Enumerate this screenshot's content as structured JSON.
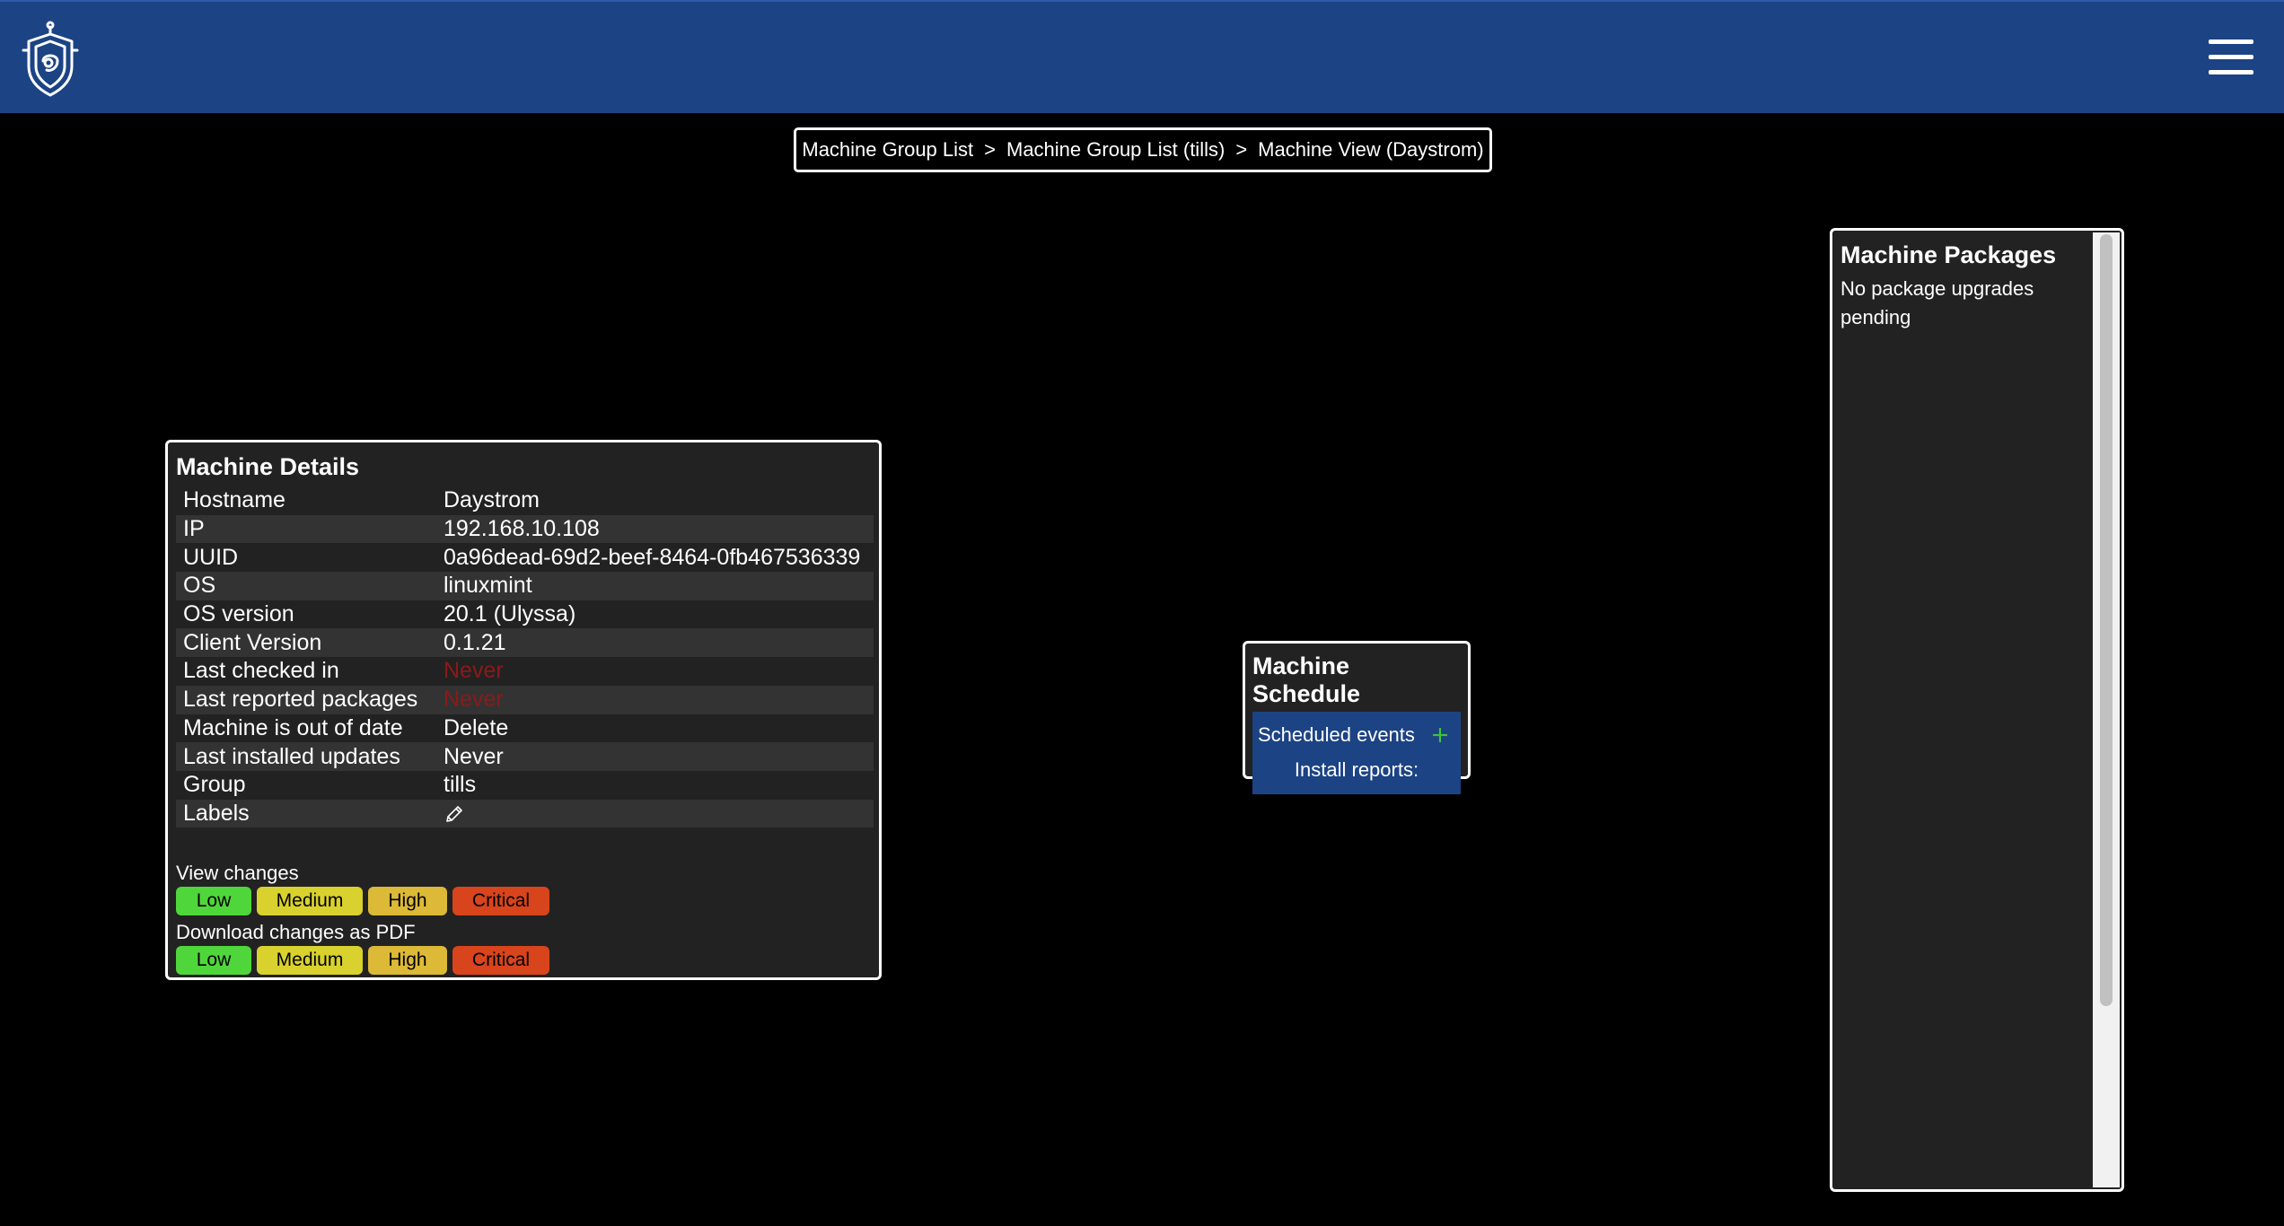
{
  "header": {
    "logo_icon": "shield-logo-icon",
    "menu_icon": "hamburger-menu-icon"
  },
  "breadcrumb": {
    "items": [
      "Machine Group List",
      "Machine Group List (tills)",
      "Machine View (Daystrom)"
    ],
    "separator": ">"
  },
  "details": {
    "title": "Machine Details",
    "rows": [
      {
        "key": "Hostname",
        "value": "Daystrom"
      },
      {
        "key": "IP",
        "value": "192.168.10.108"
      },
      {
        "key": "UUID",
        "value": "0a96dead-69d2-beef-8464-0fb467536339"
      },
      {
        "key": "OS",
        "value": "linuxmint"
      },
      {
        "key": "OS version",
        "value": "20.1 (Ulyssa)"
      },
      {
        "key": "Client Version",
        "value": "0.1.21"
      },
      {
        "key": "Last checked in",
        "value": "Never"
      },
      {
        "key": "Last reported packages",
        "value": "Never"
      },
      {
        "key": "Machine is out of date",
        "value": "Delete"
      },
      {
        "key": "Last installed updates",
        "value": "Never"
      },
      {
        "key": "Group",
        "value": "tills"
      },
      {
        "key": "Labels",
        "value": ""
      }
    ],
    "labels_icon": "pencil-icon",
    "view_changes_label": "View changes",
    "download_changes_label": "Download changes as PDF",
    "severity_buttons": {
      "low": "Low",
      "medium": "Medium",
      "high": "High",
      "critical": "Critical"
    }
  },
  "schedule": {
    "title": "Machine Schedule",
    "scheduled_events_label": "Scheduled events",
    "add_icon": "plus-icon",
    "install_reports_label": "Install reports:"
  },
  "packages": {
    "title": "Machine Packages",
    "message": "No package upgrades pending"
  },
  "colors": {
    "header_bg": "#1c4384",
    "panel_bg": "#222222",
    "never_red": "#8b1a1a",
    "low": "#4fd63b",
    "medium": "#d9d12e",
    "high": "#dcb937",
    "critical": "#d8441c"
  }
}
